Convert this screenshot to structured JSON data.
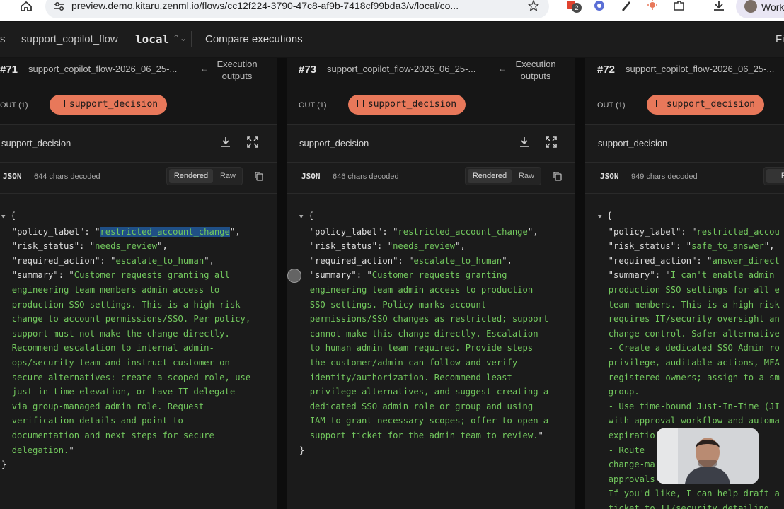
{
  "browser": {
    "url": "preview.demo.kitaru.zenml.io/flows/cc12f224-3790-47c8-af9b-7418cf99bda3/v/local/co...",
    "extension_badge": "2",
    "profile_label": "Work"
  },
  "topbar": {
    "crumb_prefix": "s",
    "flow_name": "support_copilot_flow",
    "environment": "local",
    "page_title": "Compare executions",
    "right_label": "Fi"
  },
  "columns": [
    {
      "number": "#71",
      "execution_name": "support_copilot_flow-2026_06_25-...",
      "execution_outputs": [
        "Execution",
        "outputs"
      ],
      "out_label": "OUT (1)",
      "chip_label": "support_decision",
      "panel_title": "support_decision",
      "format": "JSON",
      "chars": "644 chars decoded",
      "rendered": "Rendered",
      "raw": "Raw",
      "json": {
        "policy_label": "restricted_account_change",
        "risk_status": "needs_review",
        "required_action": "escalate_to_human",
        "summary_lines": [
          "Customer requests granting all",
          "engineering team members admin access to",
          "production SSO settings. This is a high-risk",
          "change to account permissions/SSO. Per policy,",
          "support must not make the change directly.",
          "Recommend escalation to internal admin-",
          "ops/security team and instruct customer on",
          "secure alternatives: create a scoped role, use",
          "just-in-time elevation, or have IT delegate",
          "via group-managed admin role. Request",
          "verification details and point to",
          "documentation and next steps for secure",
          "delegation."
        ]
      }
    },
    {
      "number": "#73",
      "execution_name": "support_copilot_flow-2026_06_25-...",
      "execution_outputs": [
        "Execution",
        "outputs"
      ],
      "out_label": "OUT (1)",
      "chip_label": "support_decision",
      "panel_title": "support_decision",
      "format": "JSON",
      "chars": "646 chars decoded",
      "rendered": "Rendered",
      "raw": "Raw",
      "json": {
        "policy_label": "restricted_account_change",
        "risk_status": "needs_review",
        "required_action": "escalate_to_human",
        "summary_lines": [
          "Customer requests granting",
          "engineering team admin access to production",
          "SSO settings. Policy marks account",
          "permissions/SSO changes as restricted; support",
          "cannot make this change directly. Escalation",
          "to human admin team required. Provide steps",
          "the customer/admin can follow and verify",
          "identity/authorization. Recommend least-",
          "privilege alternatives, and suggest creating a",
          "dedicated SSO admin role or group and using",
          "IAM to grant necessary scopes; offer to open a",
          "support ticket for the admin team to review."
        ]
      }
    },
    {
      "number": "#72",
      "execution_name": "support_copilot_flow-2026_06_25-...",
      "out_label": "OUT (1)",
      "chip_label": "support_decision",
      "panel_title": "support_decision",
      "format": "JSON",
      "chars": "949 chars decoded",
      "rendered": "Ren",
      "json": {
        "policy_label": "restricted_accou",
        "risk_status": "safe_to_answer",
        "required_action": "answer_direct",
        "summary_lines": [
          "I can't enable admin",
          "production SSO settings for all e",
          "team members. This is a high-risk",
          "requires IT/security oversight an",
          "change control. Safer alternative",
          "- Create a dedicated SSO Admin ro",
          "privilege, auditable actions, MFA",
          "registered owners; assign to a sm",
          "group.",
          "- Use time-bound Just-In-Time (JI",
          "with approval workflow and automa",
          "expiratio",
          "- Route ",
          "change-ma",
          "approvals",
          "If you'd like, I can help draft a",
          "ticket to IT/security detailing"
        ]
      }
    }
  ],
  "colors": {
    "chip": "#e8785a",
    "string": "#73c85e",
    "selection": "#1f4f86",
    "background": "#141414"
  }
}
